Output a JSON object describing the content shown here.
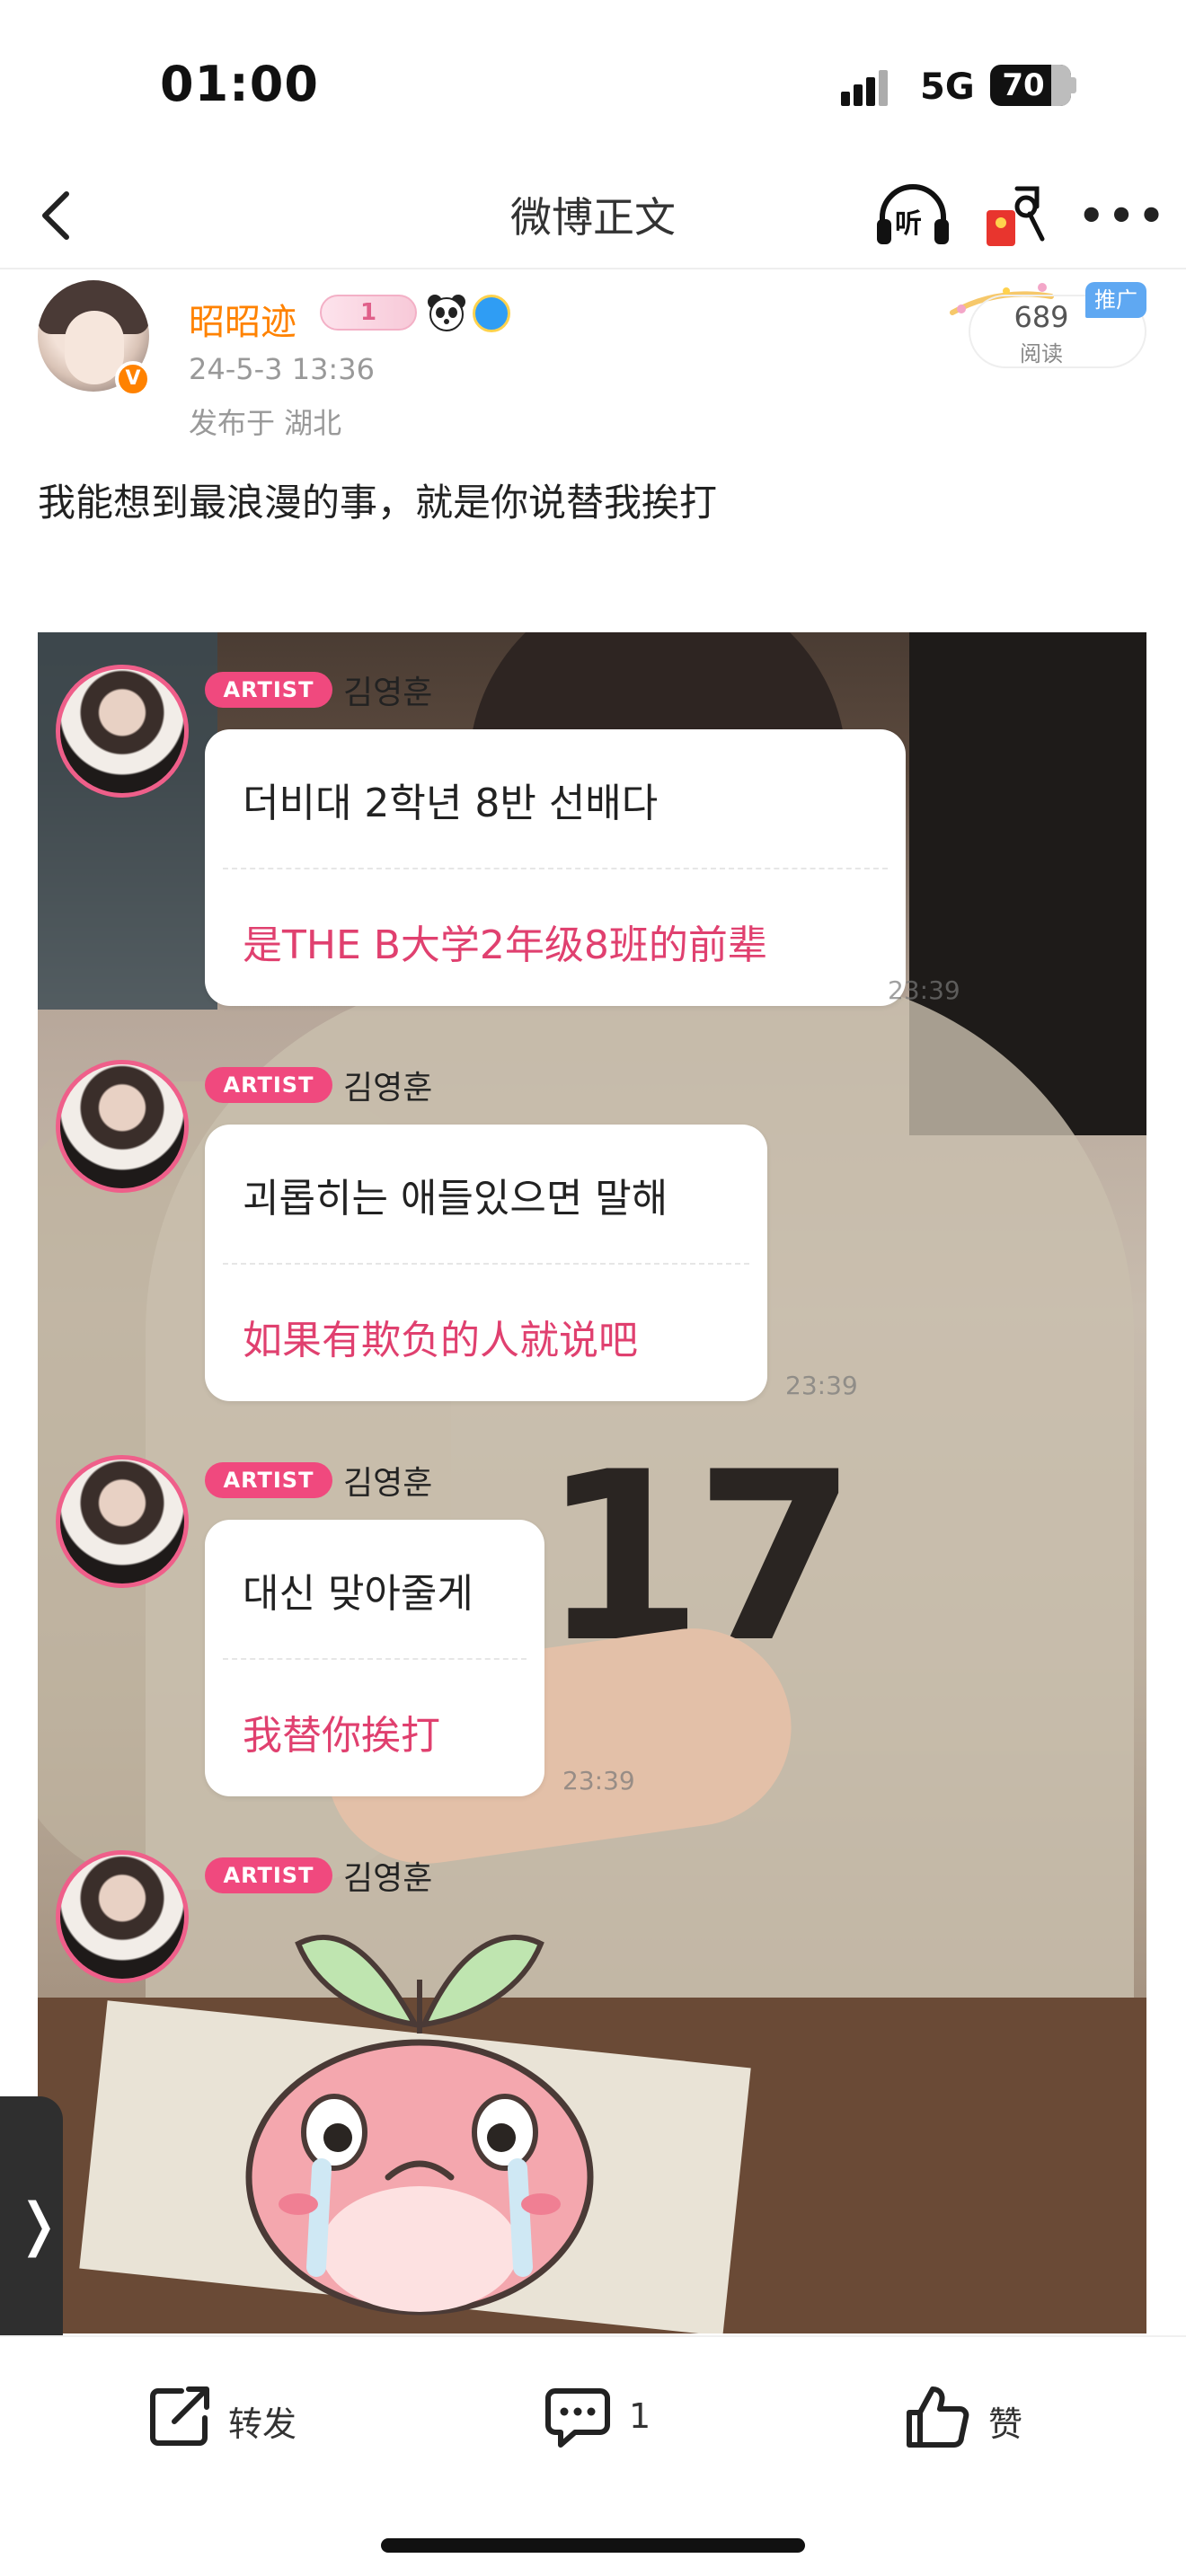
{
  "status_bar": {
    "time": "01:00",
    "network": "5G",
    "battery": "70"
  },
  "nav": {
    "title": "微博正文",
    "listen_label": "听"
  },
  "post": {
    "author": "昭昭迹",
    "level_badge": "1",
    "time": "24-5-3 13:36",
    "location": "发布于 湖北",
    "reads_count": "689",
    "reads_label": "阅读",
    "promo_tag": "推广",
    "text": "我能想到最浪漫的事，就是你说替我挨打"
  },
  "image": {
    "messages": [
      {
        "tag": "ARTIST",
        "name": "김영훈",
        "ko": "더비대 2학년 8반 선배다",
        "zh": "是THE B大学2年级8班的前辈",
        "time": "23:39"
      },
      {
        "tag": "ARTIST",
        "name": "김영훈",
        "ko": "괴롭히는 애들있으면 말해",
        "zh": "如果有欺负的人就说吧",
        "time": "23:39"
      },
      {
        "tag": "ARTIST",
        "name": "김영훈",
        "ko": "대신 맞아줄게",
        "zh": "我替你挨打",
        "time": "23:39"
      },
      {
        "tag": "ARTIST",
        "name": "김영훈"
      }
    ]
  },
  "side_tab": {
    "glyph": "❭"
  },
  "actions": {
    "repost_label": "转发",
    "comment_count": "1",
    "like_label": "赞"
  },
  "colors": {
    "accent": "#ff8200",
    "artist_pink": "#f0497e",
    "translation_pink": "#e0406f"
  }
}
